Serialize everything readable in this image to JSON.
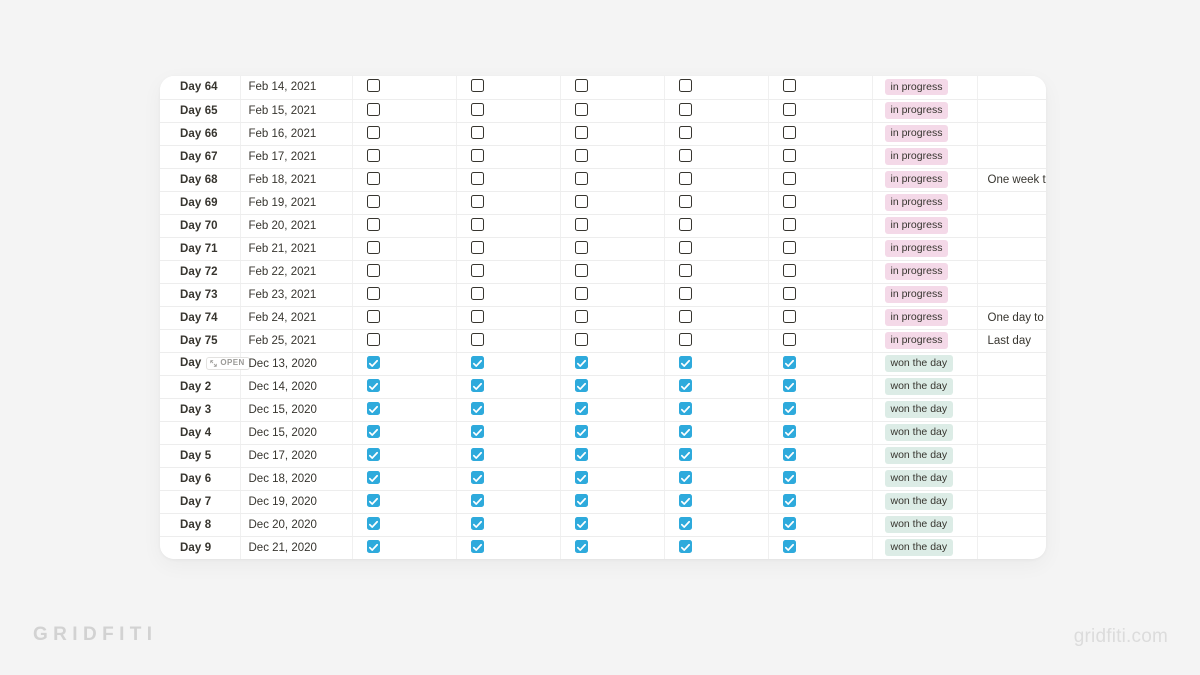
{
  "branding": {
    "left_logo": "GRIDFITI",
    "right_watermark": "gridfiti.com"
  },
  "table": {
    "open_button_label": "OPEN",
    "status_in_progress": "in progress",
    "status_won": "won the day",
    "rows": [
      {
        "day": "Day 64",
        "date": "Feb 14, 2021",
        "checks": [
          false,
          false,
          false,
          false,
          false
        ],
        "status": "in progress",
        "status_type": "progress",
        "note": ""
      },
      {
        "day": "Day 65",
        "date": "Feb 15, 2021",
        "checks": [
          false,
          false,
          false,
          false,
          false
        ],
        "status": "in progress",
        "status_type": "progress",
        "note": ""
      },
      {
        "day": "Day 66",
        "date": "Feb 16, 2021",
        "checks": [
          false,
          false,
          false,
          false,
          false
        ],
        "status": "in progress",
        "status_type": "progress",
        "note": ""
      },
      {
        "day": "Day 67",
        "date": "Feb 17, 2021",
        "checks": [
          false,
          false,
          false,
          false,
          false
        ],
        "status": "in progress",
        "status_type": "progress",
        "note": ""
      },
      {
        "day": "Day 68",
        "date": "Feb 18, 2021",
        "checks": [
          false,
          false,
          false,
          false,
          false
        ],
        "status": "in progress",
        "status_type": "progress",
        "note": "One week to go"
      },
      {
        "day": "Day 69",
        "date": "Feb 19, 2021",
        "checks": [
          false,
          false,
          false,
          false,
          false
        ],
        "status": "in progress",
        "status_type": "progress",
        "note": ""
      },
      {
        "day": "Day 70",
        "date": "Feb 20, 2021",
        "checks": [
          false,
          false,
          false,
          false,
          false
        ],
        "status": "in progress",
        "status_type": "progress",
        "note": ""
      },
      {
        "day": "Day 71",
        "date": "Feb 21, 2021",
        "checks": [
          false,
          false,
          false,
          false,
          false
        ],
        "status": "in progress",
        "status_type": "progress",
        "note": ""
      },
      {
        "day": "Day 72",
        "date": "Feb 22, 2021",
        "checks": [
          false,
          false,
          false,
          false,
          false
        ],
        "status": "in progress",
        "status_type": "progress",
        "note": ""
      },
      {
        "day": "Day 73",
        "date": "Feb 23, 2021",
        "checks": [
          false,
          false,
          false,
          false,
          false
        ],
        "status": "in progress",
        "status_type": "progress",
        "note": ""
      },
      {
        "day": "Day 74",
        "date": "Feb 24, 2021",
        "checks": [
          false,
          false,
          false,
          false,
          false
        ],
        "status": "in progress",
        "status_type": "progress",
        "note": "One day to go"
      },
      {
        "day": "Day 75",
        "date": "Feb 25, 2021",
        "checks": [
          false,
          false,
          false,
          false,
          false
        ],
        "status": "in progress",
        "status_type": "progress",
        "note": "Last day"
      },
      {
        "day": "Day",
        "date": "Dec 13, 2020",
        "checks": [
          true,
          true,
          true,
          true,
          true
        ],
        "status": "won the day",
        "status_type": "won",
        "note": "",
        "has_open_button": true
      },
      {
        "day": "Day 2",
        "date": "Dec 14, 2020",
        "checks": [
          true,
          true,
          true,
          true,
          true
        ],
        "status": "won the day",
        "status_type": "won",
        "note": ""
      },
      {
        "day": "Day 3",
        "date": "Dec 15, 2020",
        "checks": [
          true,
          true,
          true,
          true,
          true
        ],
        "status": "won the day",
        "status_type": "won",
        "note": ""
      },
      {
        "day": "Day 4",
        "date": "Dec 15, 2020",
        "checks": [
          true,
          true,
          true,
          true,
          true
        ],
        "status": "won the day",
        "status_type": "won",
        "note": ""
      },
      {
        "day": "Day 5",
        "date": "Dec 17, 2020",
        "checks": [
          true,
          true,
          true,
          true,
          true
        ],
        "status": "won the day",
        "status_type": "won",
        "note": ""
      },
      {
        "day": "Day 6",
        "date": "Dec 18, 2020",
        "checks": [
          true,
          true,
          true,
          true,
          true
        ],
        "status": "won the day",
        "status_type": "won",
        "note": ""
      },
      {
        "day": "Day 7",
        "date": "Dec 19, 2020",
        "checks": [
          true,
          true,
          true,
          true,
          true
        ],
        "status": "won the day",
        "status_type": "won",
        "note": ""
      },
      {
        "day": "Day 8",
        "date": "Dec 20, 2020",
        "checks": [
          true,
          true,
          true,
          true,
          true
        ],
        "status": "won the day",
        "status_type": "won",
        "note": ""
      },
      {
        "day": "Day 9",
        "date": "Dec 21, 2020",
        "checks": [
          true,
          true,
          true,
          true,
          true
        ],
        "status": "won the day",
        "status_type": "won",
        "note": ""
      }
    ]
  },
  "colors": {
    "page_background": "#f4f4f4",
    "card_background": "#ffffff",
    "checkbox_checked": "#2eaadc",
    "pill_in_progress": "#f4d9e8",
    "pill_won_the_day": "#dcece6",
    "row_divider": "#ededed",
    "text_primary": "#37352f",
    "brand_gray": "#d2d2d2"
  }
}
